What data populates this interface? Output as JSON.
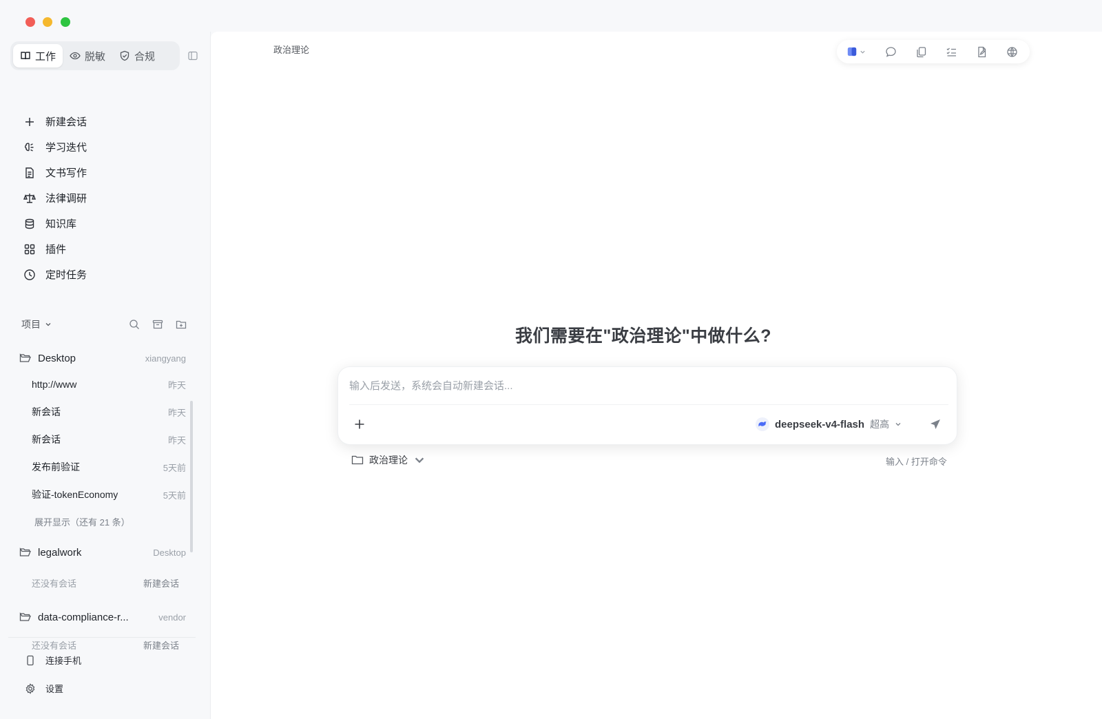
{
  "window": {
    "breadcrumb": "政治理论"
  },
  "modes": [
    {
      "label": "工作",
      "icon": "book-icon",
      "active": true
    },
    {
      "label": "脱敏",
      "icon": "eye-icon",
      "active": false
    },
    {
      "label": "合规",
      "icon": "shield-icon",
      "active": false
    }
  ],
  "nav": [
    {
      "label": "新建会话",
      "icon": "plus-icon"
    },
    {
      "label": "学习迭代",
      "icon": "brain-icon"
    },
    {
      "label": "文书写作",
      "icon": "document-icon"
    },
    {
      "label": "法律调研",
      "icon": "scale-icon"
    },
    {
      "label": "知识库",
      "icon": "database-icon"
    },
    {
      "label": "插件",
      "icon": "grid-icon"
    },
    {
      "label": "定时任务",
      "icon": "clock-icon"
    }
  ],
  "projects": {
    "title": "项目",
    "folders": [
      {
        "name": "Desktop",
        "meta": "xiangyang",
        "sessions": [
          {
            "title": "http://www",
            "time": "昨天"
          },
          {
            "title": "新会话",
            "time": "昨天"
          },
          {
            "title": "新会话",
            "time": "昨天"
          },
          {
            "title": "发布前验证",
            "time": "5天前"
          },
          {
            "title": "验证-tokenEconomy",
            "time": "5天前"
          }
        ],
        "expand": "展开显示（还有 21 条）"
      },
      {
        "name": "legalwork",
        "meta": "Desktop",
        "empty": "还没有会话",
        "new": "新建会话"
      },
      {
        "name": "data-compliance-r...",
        "meta": "vendor",
        "empty": "还没有会话",
        "new": "新建会话"
      }
    ]
  },
  "bottom": [
    {
      "label": "连接手机",
      "icon": "phone-icon"
    },
    {
      "label": "设置",
      "icon": "gear-icon"
    }
  ],
  "main": {
    "heading": "我们需要在\"政治理论\"中做什么?",
    "placeholder": "输入后发送，系统会自动新建会话...",
    "model": "deepseek-v4-flash",
    "level": "超高",
    "folder": "政治理论",
    "cmd_hint": "输入 / 打开命令"
  },
  "colors": {
    "accent": "#4a6cf7",
    "text": "#1f2329",
    "muted": "#9aa0a8"
  }
}
